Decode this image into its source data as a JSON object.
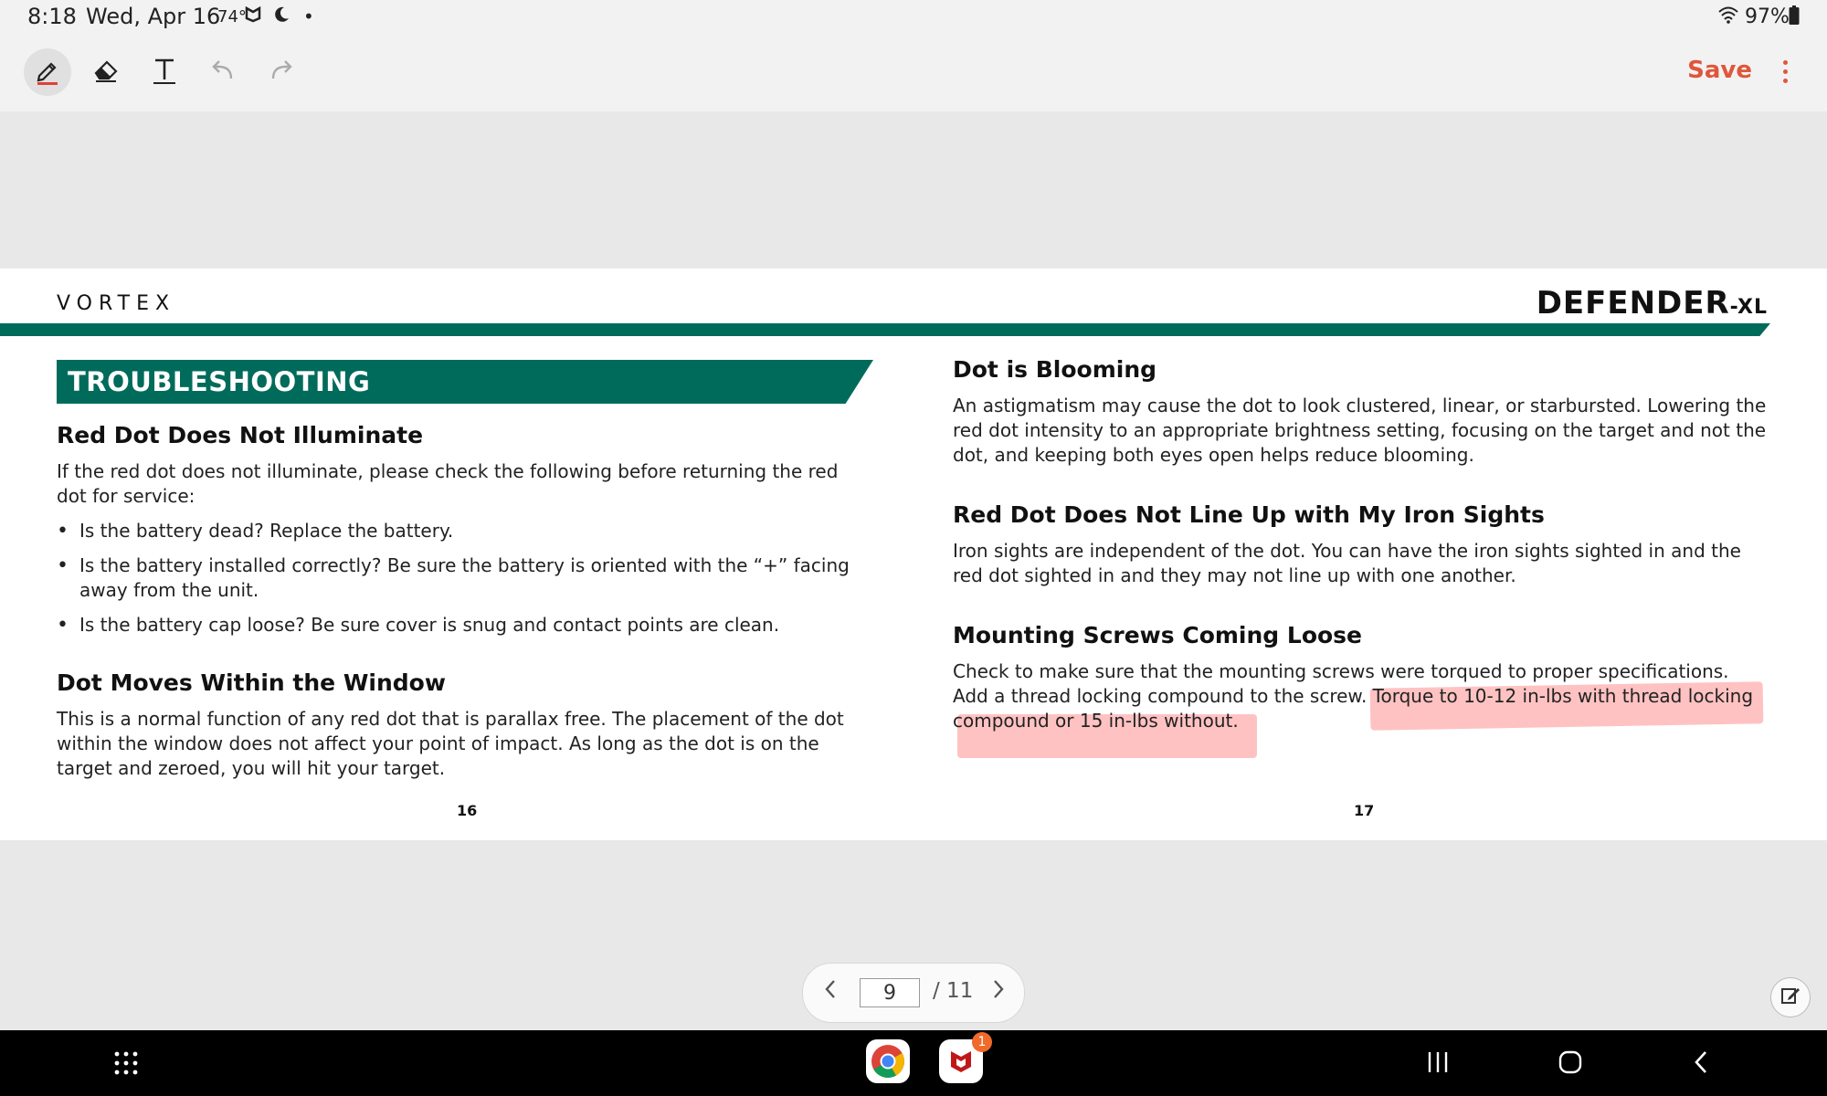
{
  "status_bar": {
    "time": "8:18",
    "date": "Wed, Apr 16",
    "temperature": "74°",
    "battery": "97%"
  },
  "toolbar": {
    "tools": [
      "pen-icon",
      "eraser-icon",
      "text-icon",
      "undo-icon",
      "redo-icon"
    ],
    "save_label": "Save"
  },
  "document": {
    "brand_left": "VORTEX",
    "brand_right": "DEFENDER",
    "brand_right_suffix": "-XL",
    "left_page": {
      "banner": "TROUBLESHOOTING",
      "section1_title": "Red Dot Does Not Illuminate",
      "section1_intro": "If the red dot does not illuminate, please check the following before returning the red dot for service:",
      "bullets": [
        "Is the battery dead? Replace the battery.",
        "Is the battery installed correctly? Be sure the battery is oriented with the “+” facing away from the unit.",
        "Is the battery cap loose? Be sure cover is snug and contact points are clean."
      ],
      "section2_title": "Dot Moves Within the Window",
      "section2_body": "This is a normal function of any red dot that is parallax free. The placement of the dot within the window does not affect your point of impact. As long as the dot is on the target and zeroed, you will hit your target.",
      "page_number": "16"
    },
    "right_page": {
      "section1_title": "Dot is Blooming",
      "section1_body": "An astigmatism may cause the dot to look clustered, linear, or starbursted. Lowering the red dot intensity to an appropriate brightness setting, focusing on the target and not the dot, and keeping both eyes open helps reduce blooming.",
      "section2_title": "Red Dot Does Not Line Up with My Iron Sights",
      "section2_body": "Iron sights are independent of the dot. You can have the iron sights sighted in and the red dot sighted in and they may not line up with one another.",
      "section3_title": "Mounting Screws Coming Loose",
      "section3_line1": "Check to make sure that the mounting screws were torqued to proper specifications.",
      "section3_line2": "Add a thread locking compound to the screw. Torque to 10-12 in-lbs with thread locking",
      "section3_line3": "compound or 15 in-lbs without.",
      "page_number": "17"
    }
  },
  "pager": {
    "current_page": "9",
    "total": "/ 11"
  },
  "taskbar": {
    "apps": [
      "chrome-app-icon",
      "mcafee-app-icon"
    ],
    "mcafee_badge": "1"
  }
}
